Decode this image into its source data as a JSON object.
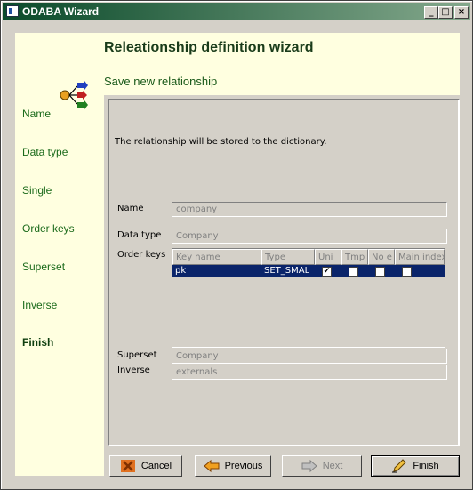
{
  "window": {
    "title": "ODABA Wizard",
    "controls": {
      "minimize": "_",
      "maximize": "□",
      "close": "×"
    }
  },
  "header": {
    "title": "Releationship definition wizard",
    "subtitle": "Save new relationship"
  },
  "sidebar": {
    "items": [
      {
        "label": "Name",
        "active": false
      },
      {
        "label": "Data type",
        "active": false
      },
      {
        "label": "Single",
        "active": false
      },
      {
        "label": "Order keys",
        "active": false
      },
      {
        "label": "Superset",
        "active": false
      },
      {
        "label": "Inverse",
        "active": false
      },
      {
        "label": "Finish",
        "active": true
      }
    ]
  },
  "main": {
    "message": "The relationship will be stored to the dictionary.",
    "fields": {
      "name": {
        "label": "Name",
        "value": "company"
      },
      "data_type": {
        "label": "Data type",
        "value": "Company"
      },
      "order_keys": {
        "label": "Order keys"
      },
      "superset": {
        "label": "Superset",
        "value": "Company"
      },
      "inverse": {
        "label": "Inverse",
        "value": "externals"
      }
    },
    "order_keys_table": {
      "columns": [
        "Key name",
        "Type",
        "Uni",
        "Tmp",
        "No e",
        "Main index"
      ],
      "rows": [
        {
          "key_name": "pk",
          "type": "SET_SMAL",
          "uni": true,
          "tmp": false,
          "no_e": false,
          "main_index": false
        }
      ]
    }
  },
  "buttons": {
    "cancel": "Cancel",
    "previous": "Previous",
    "next": "Next",
    "finish": "Finish"
  },
  "colors": {
    "sidebar_bg": "#ffffe0",
    "header_text": "#1a3c1a",
    "selection": "#0a246a"
  }
}
